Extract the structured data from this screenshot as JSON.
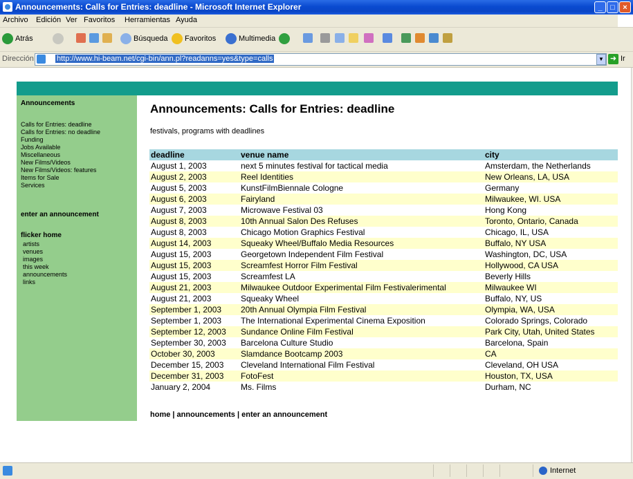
{
  "window": {
    "title": "Announcements: Calls for Entries: deadline - Microsoft Internet Explorer"
  },
  "menu": [
    "Archivo",
    "Edición",
    "Ver",
    "Favoritos",
    "Herramientas",
    "Ayuda"
  ],
  "toolbar": {
    "back": "Atrás",
    "search": "Búsqueda",
    "favorites": "Favoritos",
    "media": "Multimedia"
  },
  "address": {
    "label": "Dirección",
    "url": "http://www.hi-beam.net/cgi-bin/ann.pl?readanns=yes&type=calls",
    "go": "Ir"
  },
  "sidebar": {
    "heading": "Announcements",
    "items": [
      "Calls for Entries: deadline",
      "Calls for Entries: no deadline",
      "Funding",
      "Jobs Available",
      "Miscellaneous",
      "New Films/Videos",
      "New Films/Videos: features",
      "Items for Sale",
      "Services"
    ],
    "enter": "enter an announcement",
    "home_heading": "flicker home",
    "home_links": [
      "artists",
      "venues",
      "images",
      "this week",
      "announcements",
      "links"
    ]
  },
  "page": {
    "title": "Announcements: Calls for Entries: deadline",
    "description": "festivals, programs with deadlines",
    "columns": [
      "deadline",
      "venue name",
      "city"
    ],
    "rows": [
      [
        "August 1, 2003",
        "next 5 minutes festival for tactical media",
        "Amsterdam, the Netherlands"
      ],
      [
        "August 2, 2003",
        "Reel Identities",
        "New Orleans, LA, USA"
      ],
      [
        "August 5, 2003",
        "KunstFilmBiennale Cologne",
        "Germany"
      ],
      [
        "August 6, 2003",
        "Fairyland",
        "Milwaukee, WI. USA"
      ],
      [
        "August 7, 2003",
        "Microwave Festival 03",
        "Hong Kong"
      ],
      [
        "August 8, 2003",
        "10th Annual Salon Des Refuses",
        "Toronto, Ontario, Canada"
      ],
      [
        "August 8, 2003",
        "Chicago Motion Graphics Festival",
        "Chicago, IL, USA"
      ],
      [
        "August 14, 2003",
        "Squeaky Wheel/Buffalo Media Resources",
        "Buffalo, NY USA"
      ],
      [
        "August 15, 2003",
        "Georgetown Independent Film Festival",
        "Washington, DC, USA"
      ],
      [
        "August 15, 2003",
        "Screamfest Horror Film Festival",
        "Hollywood, CA USA"
      ],
      [
        "August 15, 2003",
        "Screamfest LA",
        "Beverly Hills"
      ],
      [
        "August 21, 2003",
        "Milwaukee Outdoor Experimental Film Festivalerimental",
        "Milwaukee WI"
      ],
      [
        "August 21, 2003",
        "Squeaky Wheel",
        "Buffalo, NY, US"
      ],
      [
        "September 1, 2003",
        "20th Annual Olympia Film Festival",
        "Olympia, WA, USA"
      ],
      [
        "September 1, 2003",
        "The International Experimental Cinema Exposition",
        "Colorado Springs, Colorado"
      ],
      [
        "September 12, 2003",
        "Sundance Online Film Festival",
        "Park City, Utah, United States"
      ],
      [
        "September 30, 2003",
        "Barcelona Culture Studio",
        "Barcelona, Spain"
      ],
      [
        "October 30, 2003",
        "Slamdance Bootcamp 2003",
        "CA"
      ],
      [
        "December 15, 2003",
        "Cleveland International Film Festival",
        "Cleveland, OH USA"
      ],
      [
        "December 31, 2003",
        "FotoFest",
        "Houston, TX, USA"
      ],
      [
        "January 2, 2004",
        "Ms. Films",
        "Durham, NC"
      ]
    ],
    "footer": {
      "home": "home",
      "announcements": "announcements",
      "enter": "enter an announcement",
      "sep": " | "
    }
  },
  "status": {
    "zone": "Internet"
  },
  "colors": {
    "banner": "#139c8c",
    "sidebar": "#94cd8c",
    "header_row": "#a7d7e0",
    "alt_row": "#ffffcc"
  }
}
